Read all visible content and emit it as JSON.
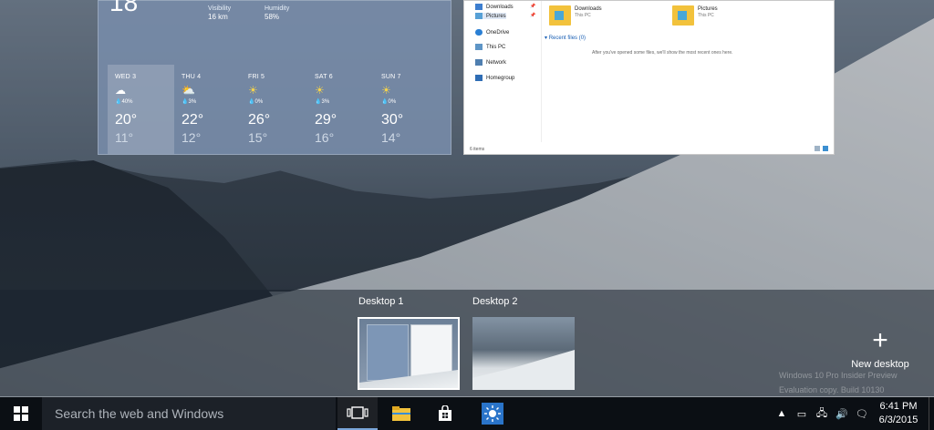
{
  "weather": {
    "current_temp": "18",
    "visibility_label": "Visibility",
    "visibility_value": "16 km",
    "humidity_label": "Humidity",
    "humidity_value": "58%",
    "days": [
      {
        "name": "WED 3",
        "icon": "cloudy-icon",
        "rain": "40%",
        "hi": "20°",
        "lo": "11°",
        "selected": true
      },
      {
        "name": "THU 4",
        "icon": "partly-sunny-icon",
        "rain": "3%",
        "hi": "22°",
        "lo": "12°",
        "selected": false
      },
      {
        "name": "FRI 5",
        "icon": "sunny-icon",
        "rain": "0%",
        "hi": "26°",
        "lo": "15°",
        "selected": false
      },
      {
        "name": "SAT 6",
        "icon": "sunny-icon",
        "rain": "3%",
        "hi": "29°",
        "lo": "16°",
        "selected": false
      },
      {
        "name": "SUN 7",
        "icon": "sunny-icon",
        "rain": "0%",
        "hi": "30°",
        "lo": "14°",
        "selected": false
      }
    ]
  },
  "explorer": {
    "nav": [
      "Downloads",
      "Pictures",
      "OneDrive",
      "This PC",
      "Network",
      "Homegroup"
    ],
    "folders": [
      {
        "name": "Downloads",
        "sub": "This PC"
      },
      {
        "name": "Pictures",
        "sub": "This PC"
      }
    ],
    "recent_header": "Recent files (0)",
    "recent_message": "After you've opened some files, we'll show the most recent ones here.",
    "status": "6 items"
  },
  "taskview": {
    "desktop1_label": "Desktop 1",
    "desktop2_label": "Desktop 2",
    "new_desktop_label": "New desktop",
    "watermark_line1": "Windows 10 Pro Insider Preview",
    "watermark_line2": "Evaluation copy. Build 10130"
  },
  "taskbar": {
    "search_placeholder": "Search the web and Windows",
    "time": "6:41 PM",
    "date": "6/3/2015"
  },
  "colors": {
    "taskbar": "#0b0f14",
    "accent": "#7aa6d9",
    "weather_bg": "#788caa"
  }
}
